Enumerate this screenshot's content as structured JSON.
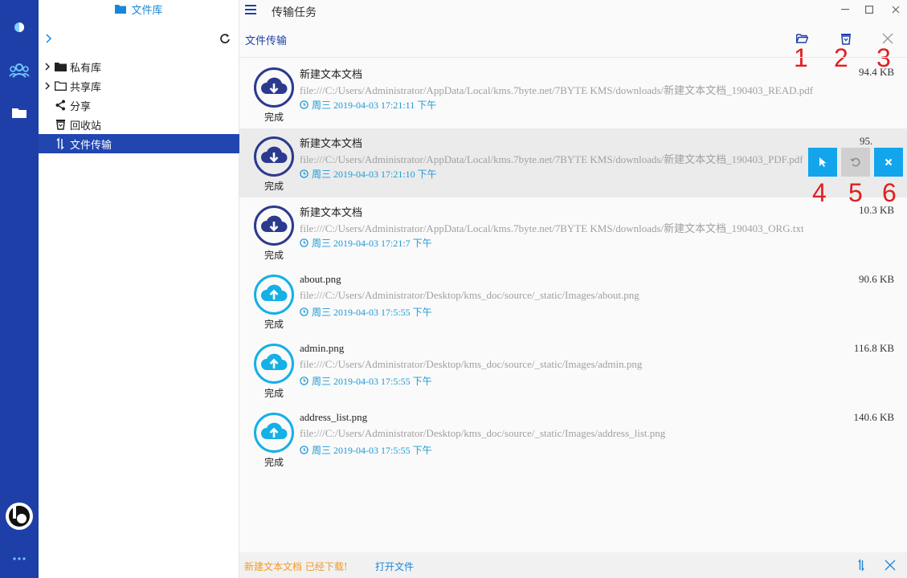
{
  "app": {
    "accent": "#1f3fa8",
    "highlight": "#12a5ec",
    "warning": "#f29a25"
  },
  "sidebar": {
    "library_title": "文件库",
    "items": [
      {
        "label": "私有库",
        "icon": "folder-filled-icon",
        "expandable": true
      },
      {
        "label": "共享库",
        "icon": "folder-outline-icon",
        "expandable": true
      },
      {
        "label": "分享",
        "icon": "share-icon",
        "expandable": false
      },
      {
        "label": "回收站",
        "icon": "recycle-bin-icon",
        "expandable": false
      },
      {
        "label": "文件传输",
        "icon": "transfer-icon",
        "expandable": false,
        "active": true
      }
    ]
  },
  "titlebar": {
    "title": "传输任务"
  },
  "section": {
    "title": "文件传输"
  },
  "callouts": {
    "c1": "1",
    "c2": "2",
    "c3": "3",
    "c4": "4",
    "c5": "5",
    "c6": "6"
  },
  "tasks": [
    {
      "direction": "download",
      "name": "新建文本文档",
      "path": "file:///C:/Users/Administrator/AppData/Local/kms.7byte.net/7BYTE KMS/downloads/新建文本文档_190403_READ.pdf",
      "time": "周三 2019-04-03 17:21:11 下午",
      "size": "94.4 KB",
      "status": "完成"
    },
    {
      "direction": "download",
      "name": "新建文本文档",
      "path": "file:///C:/Users/Administrator/AppData/Local/kms.7byte.net/7BYTE KMS/downloads/新建文本文档_190403_PDF.pdf",
      "time": "周三 2019-04-03 17:21:10 下午",
      "size": "95.",
      "status": "完成"
    },
    {
      "direction": "download",
      "name": "新建文本文档",
      "path": "file:///C:/Users/Administrator/AppData/Local/kms.7byte.net/7BYTE KMS/downloads/新建文本文档_190403_ORG.txt",
      "time": "周三 2019-04-03 17:21:7 下午",
      "size": "10.3 KB",
      "status": "完成"
    },
    {
      "direction": "upload",
      "name": "about.png",
      "path": "file:///C:/Users/Administrator/Desktop/kms_doc/source/_static/Images/about.png",
      "time": "周三 2019-04-03 17:5:55 下午",
      "size": "90.6 KB",
      "status": "完成"
    },
    {
      "direction": "upload",
      "name": "admin.png",
      "path": "file:///C:/Users/Administrator/Desktop/kms_doc/source/_static/Images/admin.png",
      "time": "周三 2019-04-03 17:5:55 下午",
      "size": "116.8 KB",
      "status": "完成"
    },
    {
      "direction": "upload",
      "name": "address_list.png",
      "path": "file:///C:/Users/Administrator/Desktop/kms_doc/source/_static/Images/address_list.png",
      "time": "周三 2019-04-03 17:5:55 下午",
      "size": "140.6 KB",
      "status": "完成"
    }
  ],
  "footer": {
    "message": "新建文本文档 已经下载!",
    "open_link": "打开文件"
  }
}
